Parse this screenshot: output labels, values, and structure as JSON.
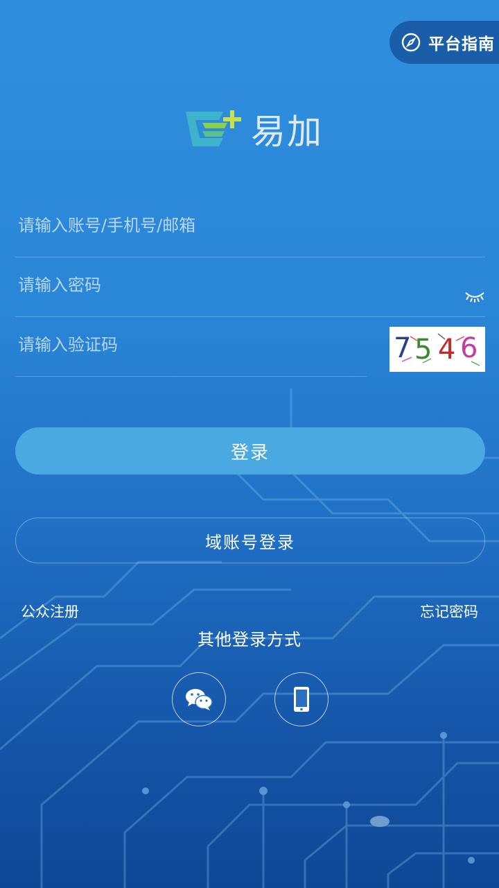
{
  "header": {
    "guide_label": "平台指南"
  },
  "logo": {
    "name": "易加"
  },
  "form": {
    "account_placeholder": "请输入账号/手机号/邮箱",
    "password_placeholder": "请输入密码",
    "captcha_placeholder": "请输入验证码",
    "captcha_digits": [
      "7",
      "5",
      "4",
      "6"
    ],
    "captcha_colors": [
      "#2b3f8f",
      "#3a8a2c",
      "#c8282a",
      "#c53c9e"
    ]
  },
  "actions": {
    "login_label": "登录",
    "domain_login_label": "域账号登录",
    "register_label": "公众注册",
    "forgot_label": "忘记密码"
  },
  "other_login": {
    "title": "其他登录方式",
    "methods": [
      "wechat-icon",
      "phone-icon"
    ]
  }
}
